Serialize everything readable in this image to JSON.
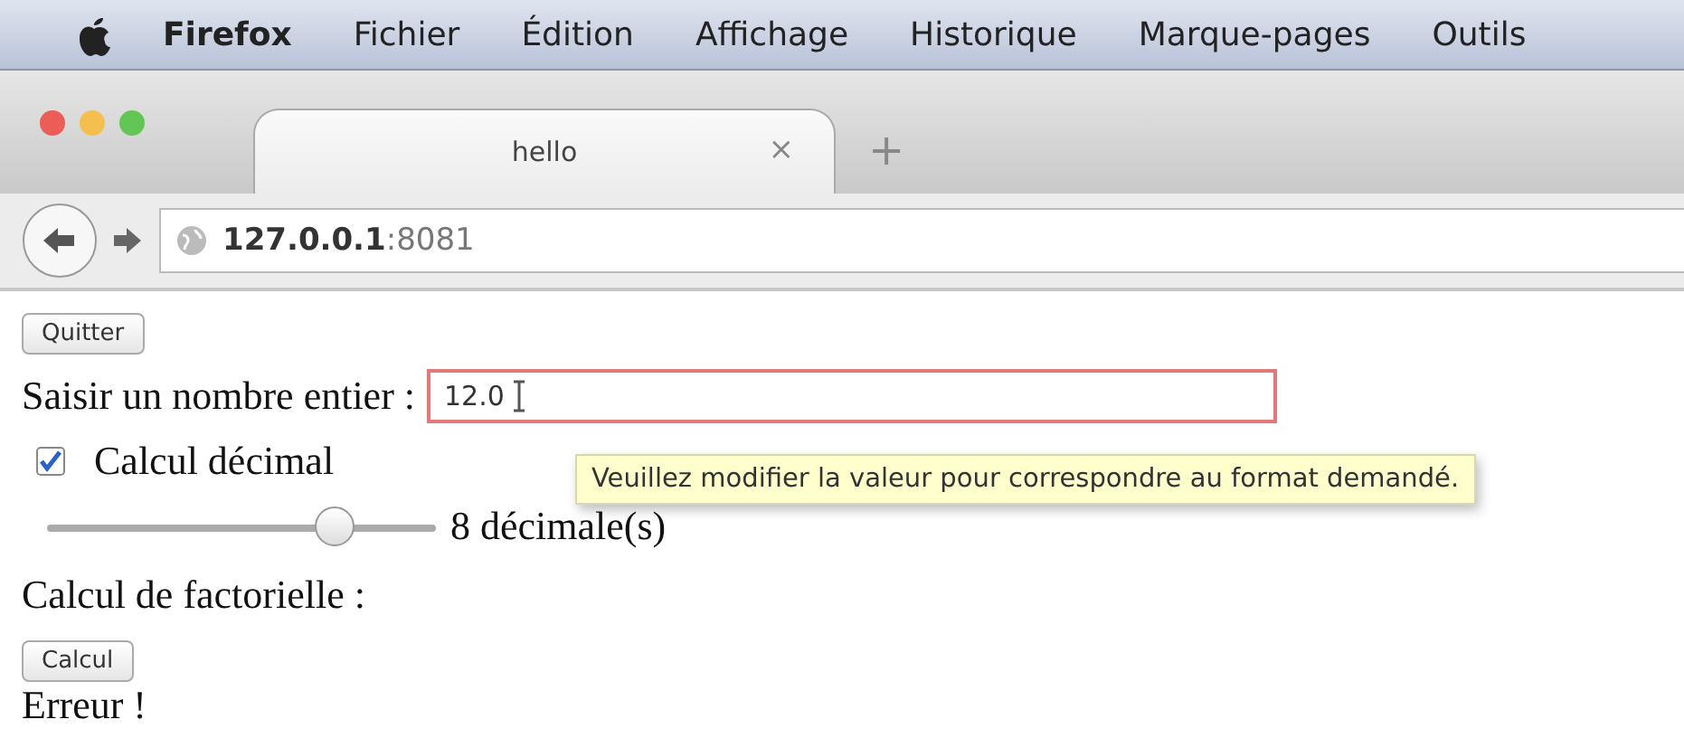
{
  "menu_bar": {
    "app_name": "Firefox",
    "items": [
      "Fichier",
      "Édition",
      "Affichage",
      "Historique",
      "Marque-pages",
      "Outils"
    ]
  },
  "tabs": [
    {
      "label": "hello",
      "close": "×",
      "selected": true
    }
  ],
  "new_tab": "+",
  "address_bar": {
    "host": "127.0.0.1",
    "port": ":8081"
  },
  "page": {
    "quit_button": "Quitter",
    "number_label": "Saisir un nombre entier :",
    "number_value": "12.0",
    "number_invalid": true,
    "tooltip": "Veuillez modifier la valeur pour correspondre au format demandé.",
    "decimal_checkbox": {
      "label": "Calcul décimal",
      "checked": true
    },
    "slider": {
      "level": 0.74,
      "reading": "8 décimale(s)"
    },
    "factorial_label": "Calcul de factorielle :",
    "calc_button": "Calcul",
    "result": "Erreur !"
  }
}
